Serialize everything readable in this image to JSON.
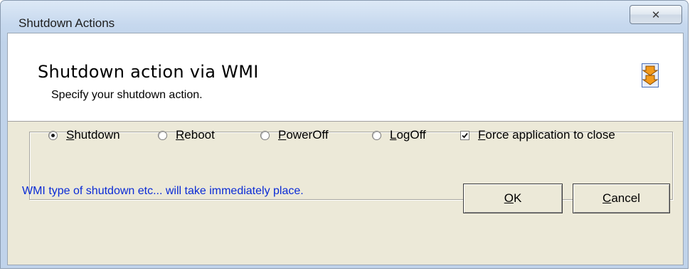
{
  "window": {
    "title": "Shutdown Actions",
    "close_glyph": "✕"
  },
  "header": {
    "title": "Shutdown action via WMI",
    "subtitle": "Specify your shutdown action.",
    "icon": "double-arrow-down-icon"
  },
  "options": [
    {
      "label_first": "S",
      "label_rest": "hutdown",
      "selected": true
    },
    {
      "label_first": "R",
      "label_rest": "eboot",
      "selected": false
    },
    {
      "label_first": "P",
      "label_rest": "owerOff",
      "selected": false
    },
    {
      "label_first": "L",
      "label_rest": "ogOff",
      "selected": false
    }
  ],
  "force_close": {
    "label_first": "F",
    "label_rest": "orce application to close",
    "checked": true
  },
  "note": "WMI type of shutdown etc... will take immediately place.",
  "buttons": {
    "ok_first": "O",
    "ok_rest": "K",
    "cancel_first": "C",
    "cancel_rest": "ancel"
  },
  "colors": {
    "note_text": "#0a2bd6",
    "icon_orange": "#f39a1b"
  }
}
